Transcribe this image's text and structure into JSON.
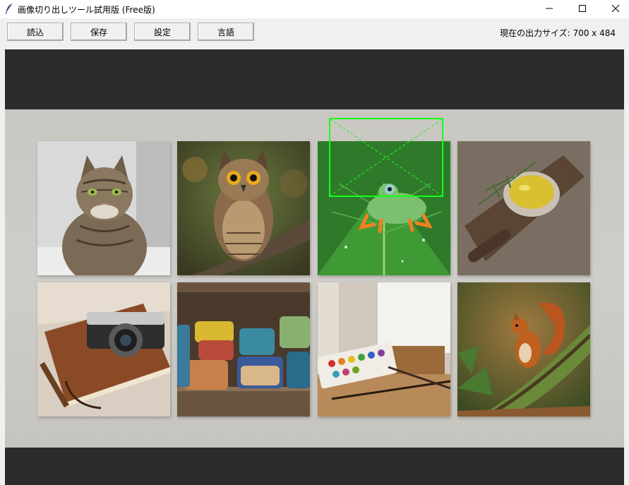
{
  "window": {
    "title": "画像切り出しツール試用版 (Free版)",
    "icon": "feather-icon",
    "controls": [
      "minimize-icon",
      "maximize-icon",
      "close-icon"
    ]
  },
  "toolbar": {
    "load_label": "読込",
    "save_label": "保存",
    "settings_label": "設定",
    "language_label": "言語",
    "output_size_label": "現在の出力サイズ: 700 x 484"
  },
  "colors": {
    "canvas_background": "#2b2b2b",
    "board_background": "#cbc9c4",
    "selection_border": "#16ff16"
  },
  "grid": {
    "rows": 2,
    "columns": 4,
    "images": [
      "cat",
      "owl",
      "frog",
      "olive-oil-bowl",
      "camera-and-notebook",
      "ceramic-mugs",
      "watercolor-easel",
      "squirrel"
    ]
  },
  "selection": {
    "target_image": "frog",
    "diagonals": "dashed"
  }
}
